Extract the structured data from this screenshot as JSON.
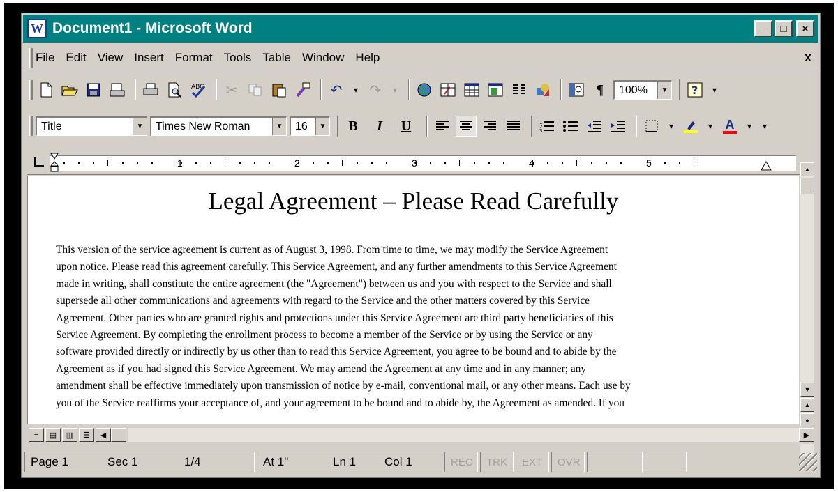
{
  "window": {
    "title": "Document1 - Microsoft Word",
    "controls": {
      "minimize": "_",
      "maximize": "□",
      "close": "×"
    }
  },
  "menu": {
    "items": [
      "File",
      "Edit",
      "View",
      "Insert",
      "Format",
      "Tools",
      "Table",
      "Window",
      "Help"
    ],
    "doc_close": "x"
  },
  "standard_toolbar": {
    "zoom": "100%",
    "icons": [
      "new-icon",
      "open-icon",
      "save-icon",
      "email-icon",
      "print-icon",
      "print-preview-icon",
      "spelling-icon",
      "cut-icon",
      "copy-icon",
      "paste-icon",
      "format-painter-icon",
      "undo-icon",
      "redo-icon",
      "web-toolbar-icon",
      "tables-borders-icon",
      "insert-table-icon",
      "insert-excel-icon",
      "columns-icon",
      "drawing-icon",
      "document-map-icon",
      "show-formatting-icon",
      "help-icon"
    ]
  },
  "formatting_toolbar": {
    "style": "Title",
    "font": "Times New Roman",
    "size": "16",
    "bold": "B",
    "italic": "I",
    "underline": "U",
    "font_color_letter": "A",
    "highlight_color": "#ffff00",
    "font_color": "#ff0000"
  },
  "ruler": {
    "numbers": [
      "1",
      "2",
      "3",
      "4",
      "5"
    ]
  },
  "document": {
    "title": "Legal Agreement – Please Read Carefully",
    "lines": [
      "This version of the service agreement is current as of August 3, 1998.  From time to time, we may modify the Service Agreement",
      "upon notice. Please read this agreement carefully.  This Service Agreement, and any further amendments to this Service Agreement",
      "made in writing, shall constitute the entire agreement (the \"Agreement\") between us and you with respect to the Service and shall",
      "supersede all other communications and agreements with regard to the Service and the other matters covered by this Service",
      "Agreement.  Other parties who are granted rights and protections under this Service Agreement are third party beneficiaries of this",
      "Service Agreement.  By completing the enrollment process to become a member of the Service or by using the Service or any",
      "software provided directly or indirectly by us other than to read this Service Agreement, you agree to be bound and to abide by the",
      "Agreement as if you had signed this Service Agreement.  We may amend the Agreement at any time and in any manner; any",
      "amendment shall be effective immediately upon transmission of notice by e-mail, conventional mail, or any other means.  Each use by",
      "you of the Service reaffirms your acceptance of, and your agreement to be bound and to abide by, the Agreement as amended.  If you"
    ]
  },
  "status": {
    "page": "Page 1",
    "sec": "Sec 1",
    "pages": "1/4",
    "at": "At 1\"",
    "ln": "Ln 1",
    "col": "Col 1",
    "rec": "REC",
    "trk": "TRK",
    "ext": "EXT",
    "ovr": "OVR"
  }
}
